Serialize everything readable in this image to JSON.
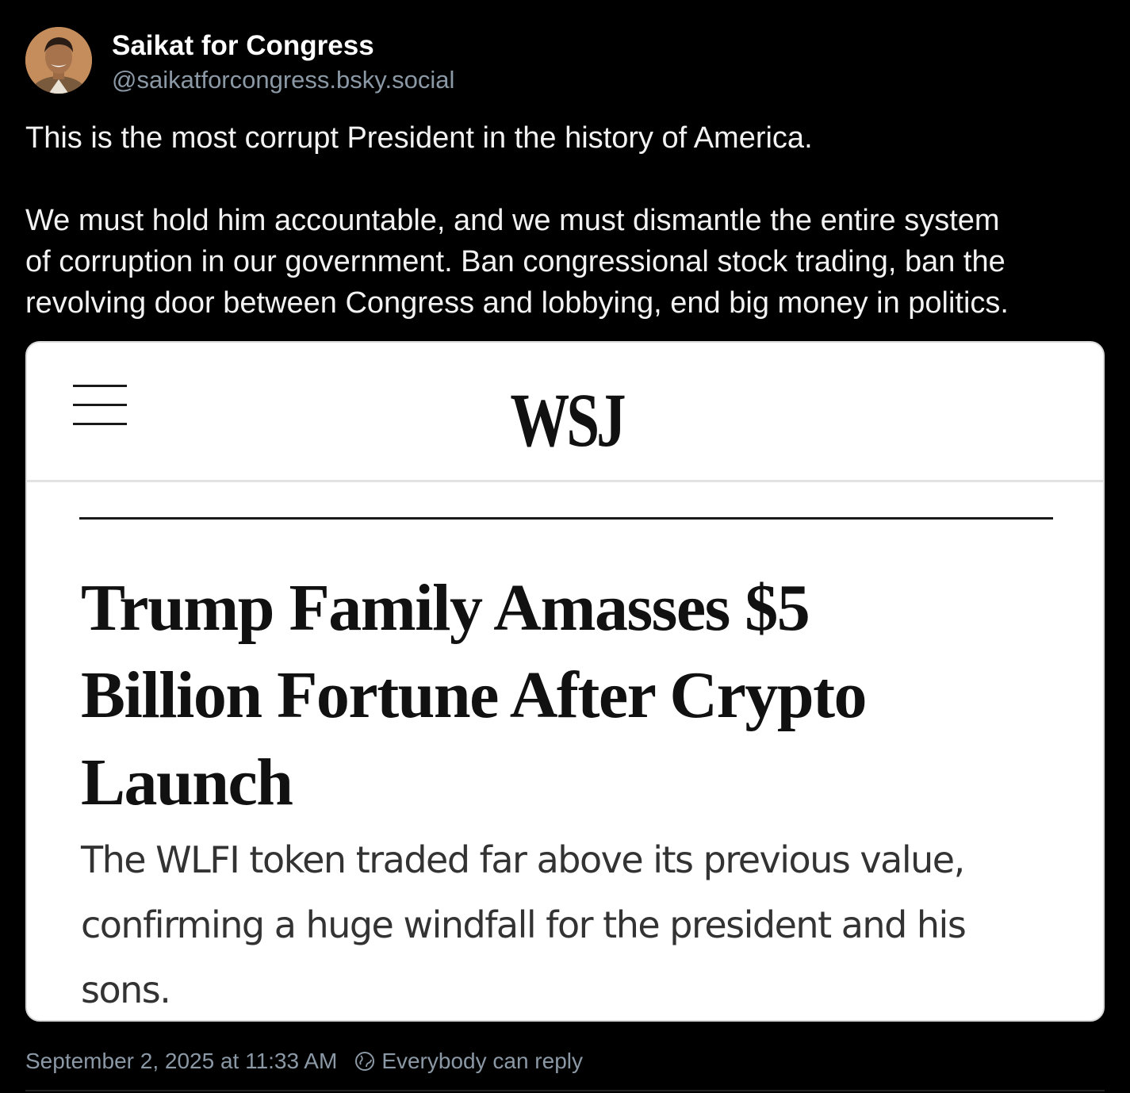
{
  "author": {
    "display_name": "Saikat for Congress",
    "handle": "@saikatforcongress.bsky.social"
  },
  "post": {
    "paragraphs": [
      "This is the most corrupt President in the history of America.",
      "We must hold him accountable, and we must dismantle the entire system",
      "of corruption in our government. Ban congressional stock trading, ban the",
      "revolving door between Congress and lobbying, end big money in politics."
    ]
  },
  "embed": {
    "logo": "WSJ",
    "menu_icon": "hamburger-menu-icon",
    "headline_lines": [
      "Trump Family Amasses $5",
      "Billion Fortune After Crypto",
      "Launch"
    ],
    "subhead_lines": [
      "The WLFI token traded far above its previous value,",
      "confirming a huge windfall for the president and his",
      "sons."
    ]
  },
  "meta": {
    "timestamp": "September 2, 2025 at 11:33 AM",
    "reply_setting": "Everybody can reply",
    "reply_icon": "globe-icon"
  },
  "colors": {
    "background": "#000000",
    "text": "#ffffff",
    "muted": "#8b98a5"
  }
}
